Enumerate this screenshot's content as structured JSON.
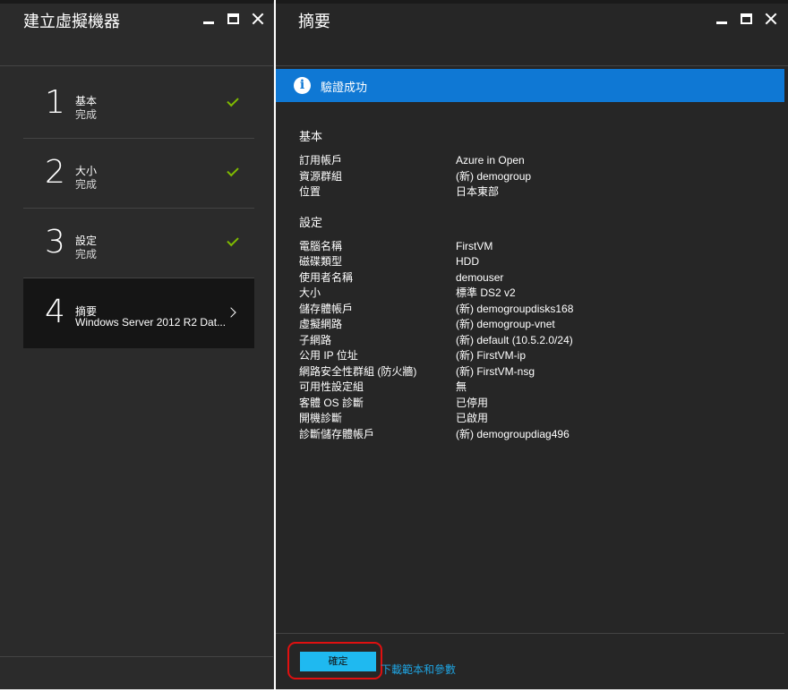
{
  "left_blade": {
    "title": "建立虛擬機器",
    "steps": [
      {
        "number": "1",
        "title": "基本",
        "subtitle": "完成",
        "status": "complete"
      },
      {
        "number": "2",
        "title": "大小",
        "subtitle": "完成",
        "status": "complete"
      },
      {
        "number": "3",
        "title": "設定",
        "subtitle": "完成",
        "status": "complete"
      },
      {
        "number": "4",
        "title": "摘要",
        "subtitle": "Windows Server 2012 R2 Dat...",
        "status": "active"
      }
    ]
  },
  "right_blade": {
    "title": "摘要",
    "banner": {
      "text": "驗證成功",
      "color": "#0f78d4"
    },
    "sections": [
      {
        "title": "基本",
        "rows": [
          {
            "key": "訂用帳戶",
            "value": "Azure in Open"
          },
          {
            "key": "資源群組",
            "value": "(新) demogroup"
          },
          {
            "key": "位置",
            "value": "日本東部"
          }
        ]
      },
      {
        "title": "設定",
        "rows": [
          {
            "key": "電腦名稱",
            "value": "FirstVM"
          },
          {
            "key": "磁碟類型",
            "value": "HDD"
          },
          {
            "key": "使用者名稱",
            "value": "demouser"
          },
          {
            "key": "大小",
            "value": "標準 DS2 v2"
          },
          {
            "key": "儲存體帳戶",
            "value": "(新) demogroupdisks168"
          },
          {
            "key": "虛擬網路",
            "value": "(新) demogroup-vnet"
          },
          {
            "key": "子網路",
            "value": "(新) default (10.5.2.0/24)"
          },
          {
            "key": "公用 IP 位址",
            "value": "(新) FirstVM-ip"
          },
          {
            "key": "網路安全性群組 (防火牆)",
            "value": "(新) FirstVM-nsg"
          },
          {
            "key": "可用性設定組",
            "value": "無"
          },
          {
            "key": "客體 OS 診斷",
            "value": "已停用"
          },
          {
            "key": "開機診斷",
            "value": "已啟用"
          },
          {
            "key": "診斷儲存體帳戶",
            "value": "(新) demogroupdiag496"
          }
        ]
      }
    ],
    "ok_button": "確定",
    "download_link": "下載範本和參數"
  },
  "colors": {
    "accent": "#1fb9f0",
    "check": "#7fba00",
    "highlight": "#e01010"
  }
}
